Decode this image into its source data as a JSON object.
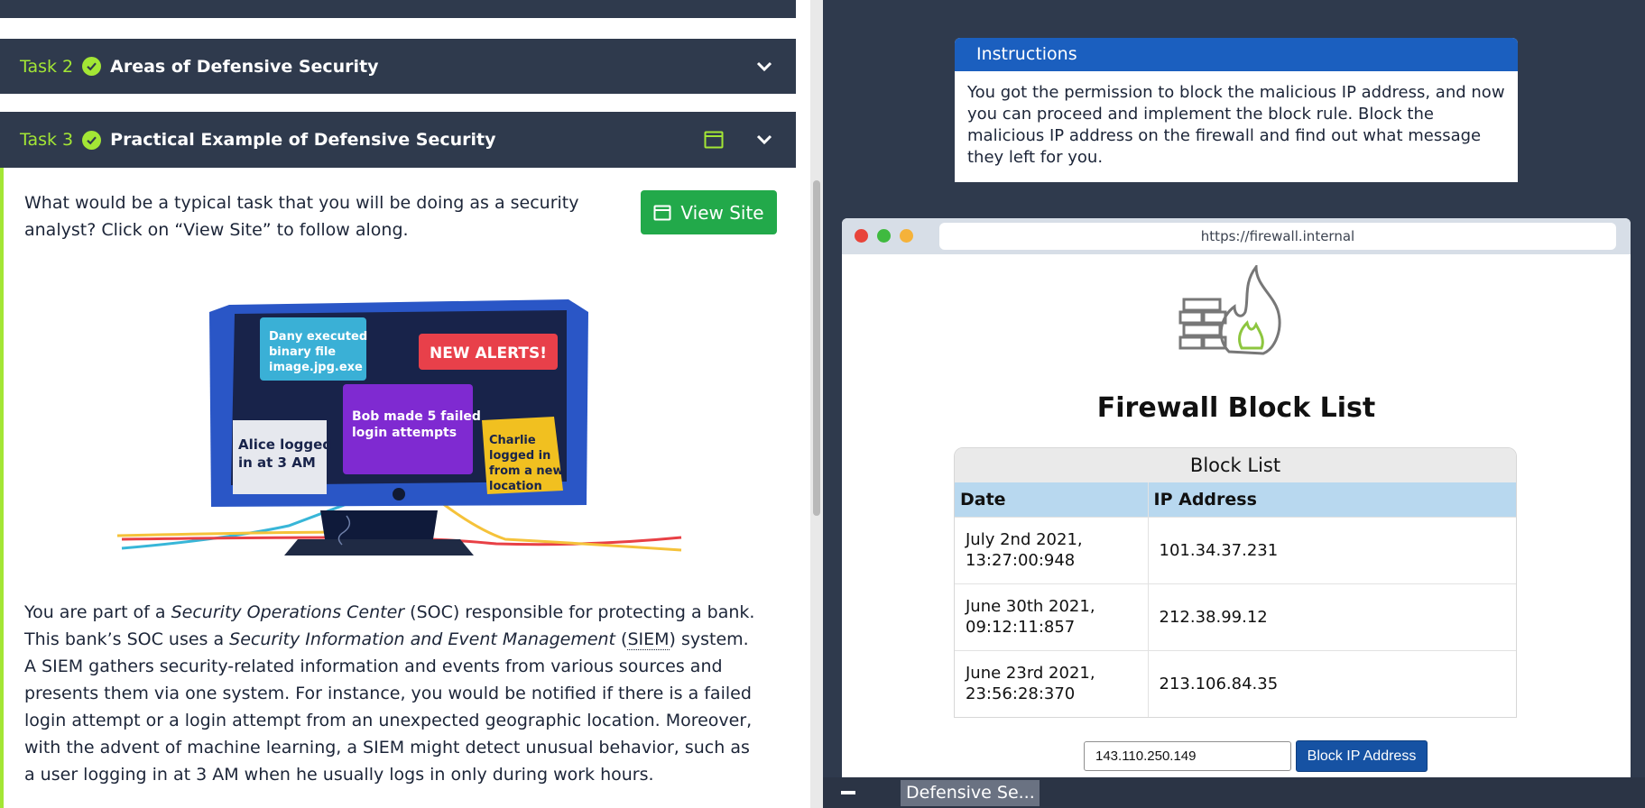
{
  "tasks": [
    {
      "number": "Task 2",
      "title": "Areas of Defensive Security"
    },
    {
      "number": "Task 3",
      "title": "Practical Example of Defensive Security"
    }
  ],
  "task3": {
    "question": "What would be a typical task that you will be doing as a security analyst? Click on “View Site” to follow along.",
    "view_site_label": "View Site",
    "illustration": {
      "alert_header": "NEW ALERTS!",
      "cards": [
        "Dany executed",
        "binary file",
        "image.jpg.exe",
        "Bob made 5 failed",
        "login attempts",
        "Alice logged",
        "in at 3 AM",
        "Charlie",
        "logged in",
        "from a new",
        "location"
      ]
    },
    "paragraph": {
      "p1": "You are part of a ",
      "soc_term": "Security Operations Center",
      "p2": " (SOC) responsible for protecting a bank. This bank’s SOC uses a ",
      "siem_term": "Security Information and Event Management",
      "p3": " (",
      "siem_abbr": "SIEM",
      "p4": ") system. A SIEM gathers security-related information and events from various sources and presents them via one system. For instance, you would be notified if there is a failed login attempt or a login attempt from an unexpected geographic location. Moreover, with the advent of machine learning, a SIEM might detect unusual behavior, such as a user logging in at 3 AM when he usually logs in only during work hours."
    }
  },
  "instructions": {
    "title": "Instructions",
    "text": "You got the permission to block the malicious IP address, and now you can proceed and implement the block rule. Block the malicious IP address on the firewall and find out what message they left for you."
  },
  "browser": {
    "url": "https://firewall.internal",
    "page_title": "Firewall Block List",
    "block_list": {
      "caption": "Block List",
      "headers": [
        "Date",
        "IP Address"
      ],
      "rows": [
        {
          "date_line1": "July 2nd 2021,",
          "date_line2": "13:27:00:948",
          "ip": "101.34.37.231"
        },
        {
          "date_line1": "June 30th 2021,",
          "date_line2": "09:12:11:857",
          "ip": "212.38.99.12"
        },
        {
          "date_line1": "June 23rd 2021,",
          "date_line2": "23:56:28:370",
          "ip": "213.106.84.35"
        }
      ]
    },
    "ip_input_value": "143.110.250.149",
    "block_button_label": "Block IP Address"
  },
  "taskbar": {
    "tab_label": "Defensive Se..."
  },
  "colors": {
    "accent_green": "#a3e635",
    "header_dark": "#2f3a4d",
    "view_site_green": "#22a94a",
    "instructions_blue": "#1b5fbf",
    "block_button_blue": "#1652a3"
  }
}
